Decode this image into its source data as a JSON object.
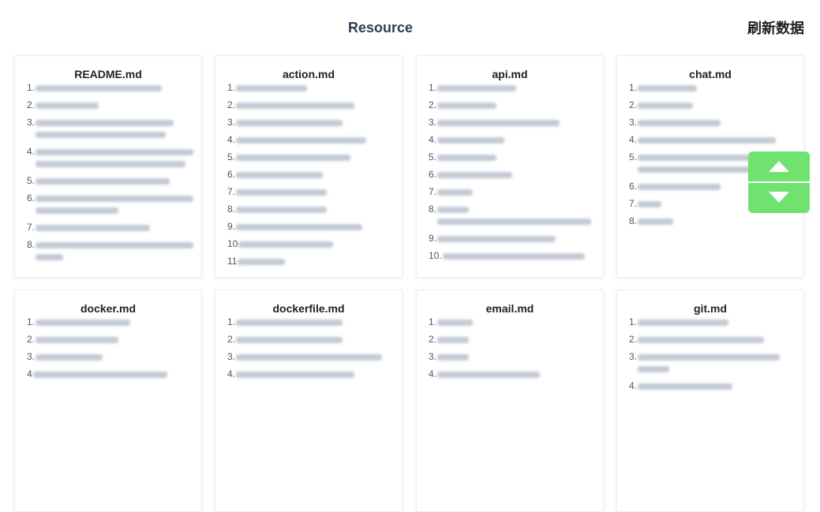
{
  "header": {
    "title": "Resource",
    "refresh_label": "刷新数据"
  },
  "cards": [
    {
      "title": "README.md",
      "items": [
        "1.",
        "2.",
        "3.",
        "4.",
        "5.",
        "6.",
        "7.",
        "8."
      ]
    },
    {
      "title": "action.md",
      "items": [
        "1.",
        "2.",
        "3.",
        "4.",
        "5.",
        "6.",
        "7.",
        "8.",
        "9.",
        "10",
        "11"
      ]
    },
    {
      "title": "api.md",
      "items": [
        "1.",
        "2.",
        "3.",
        "4.",
        "5.",
        "6.",
        "7.",
        "8.",
        "9.",
        "10."
      ]
    },
    {
      "title": "chat.md",
      "items": [
        "1.",
        "2.",
        "3.",
        "4.",
        "5.",
        "6.",
        "7.",
        "8."
      ]
    },
    {
      "title": "docker.md",
      "items": [
        "1.",
        "2.",
        "3.",
        "4"
      ]
    },
    {
      "title": "dockerfile.md",
      "items": [
        "1.",
        "2.",
        "3.",
        "4."
      ]
    },
    {
      "title": "email.md",
      "items": [
        "1.",
        "2.",
        "3.",
        "4."
      ]
    },
    {
      "title": "git.md",
      "items": [
        "1.",
        "2.",
        "3.",
        "4."
      ]
    }
  ],
  "scroll_buttons": {
    "up_icon": "triangle-up-icon",
    "down_icon": "triangle-down-icon",
    "color": "#6fe26f"
  },
  "colors": {
    "title": "#2c3e50",
    "card_border": "#eceef2",
    "item_text": "#555555"
  }
}
